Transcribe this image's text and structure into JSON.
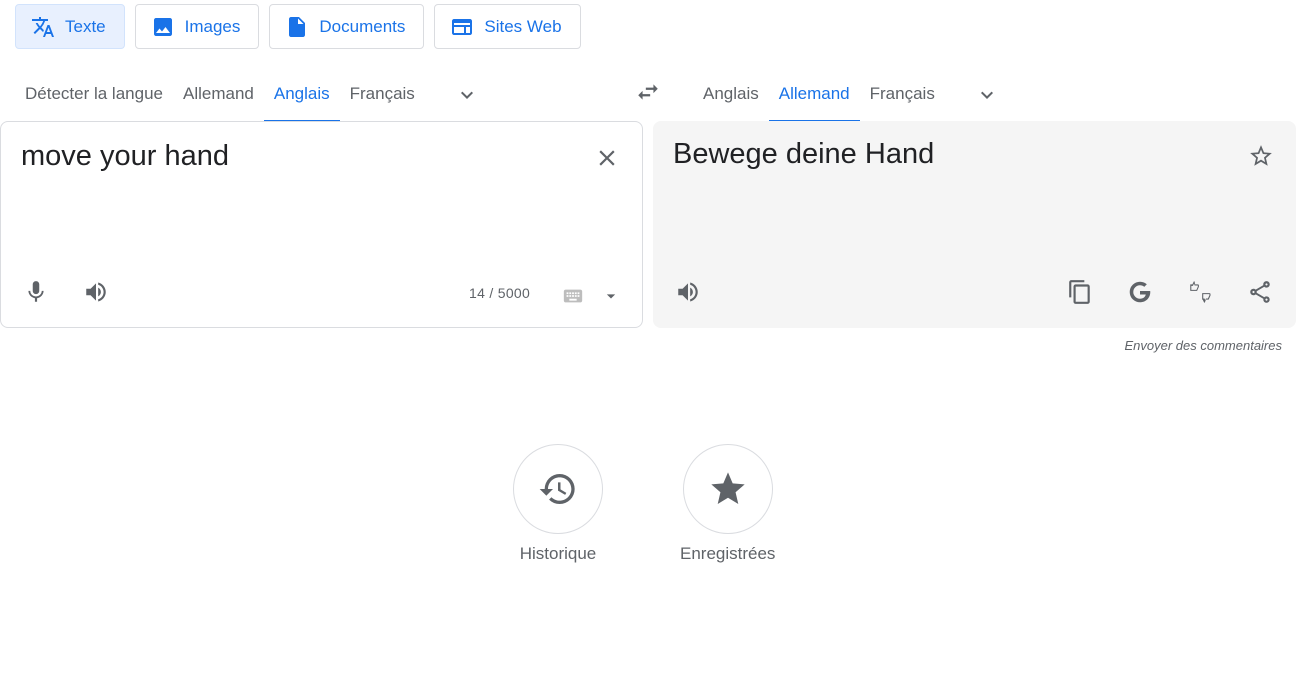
{
  "modes": [
    {
      "label": "Texte",
      "icon": "translate-icon",
      "active": true
    },
    {
      "label": "Images",
      "icon": "image-icon",
      "active": false
    },
    {
      "label": "Documents",
      "icon": "document-icon",
      "active": false
    },
    {
      "label": "Sites Web",
      "icon": "website-icon",
      "active": false
    }
  ],
  "source_languages": {
    "tabs": [
      "Détecter la langue",
      "Allemand",
      "Anglais",
      "Français"
    ],
    "selected": "Anglais"
  },
  "target_languages": {
    "tabs": [
      "Anglais",
      "Allemand",
      "Français"
    ],
    "selected": "Allemand"
  },
  "source": {
    "text": "move your hand",
    "char_count": "14 / 5000"
  },
  "target": {
    "text": "Bewege deine Hand"
  },
  "feedback_label": "Envoyer des commentaires",
  "shortcuts": {
    "history_label": "Historique",
    "saved_label": "Enregistrées"
  },
  "colors": {
    "accent": "#1a73e8",
    "active_tab_bg": "#e8f0fe",
    "target_panel_bg": "#f5f5f5",
    "icon": "#5f6368"
  }
}
